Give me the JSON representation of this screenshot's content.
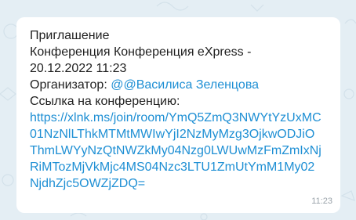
{
  "message": {
    "title": "Приглашение",
    "conference": "Конференция Конференция eXpress -",
    "datetime": "20.12.2022 11:23",
    "organizer_label": "Организатор: ",
    "organizer_mention": "@@Василиса Зеленцова",
    "link_label": "Ссылка на конференцию:",
    "link": "https://xlnk.ms/join/room/YmQ5ZmQ3NWYtYzUxMC01NzNlLThkMTMtMWIwYjI2NzMyMzg3OjkwODJiOThmLWYyNzQtNWZkMy04Nzg0LWUwMzFmZmIxNjRiMTozMjVkMjc4MS04Nzc3LTU1ZmUtYmM1My02NjdhZjc5OWZjZDQ=",
    "time": "11:23"
  },
  "colors": {
    "background": "#e4eef4",
    "bubble": "#ffffff",
    "text": "#1f1f1f",
    "link": "#1e8fd4",
    "time": "#9aa3aa"
  }
}
